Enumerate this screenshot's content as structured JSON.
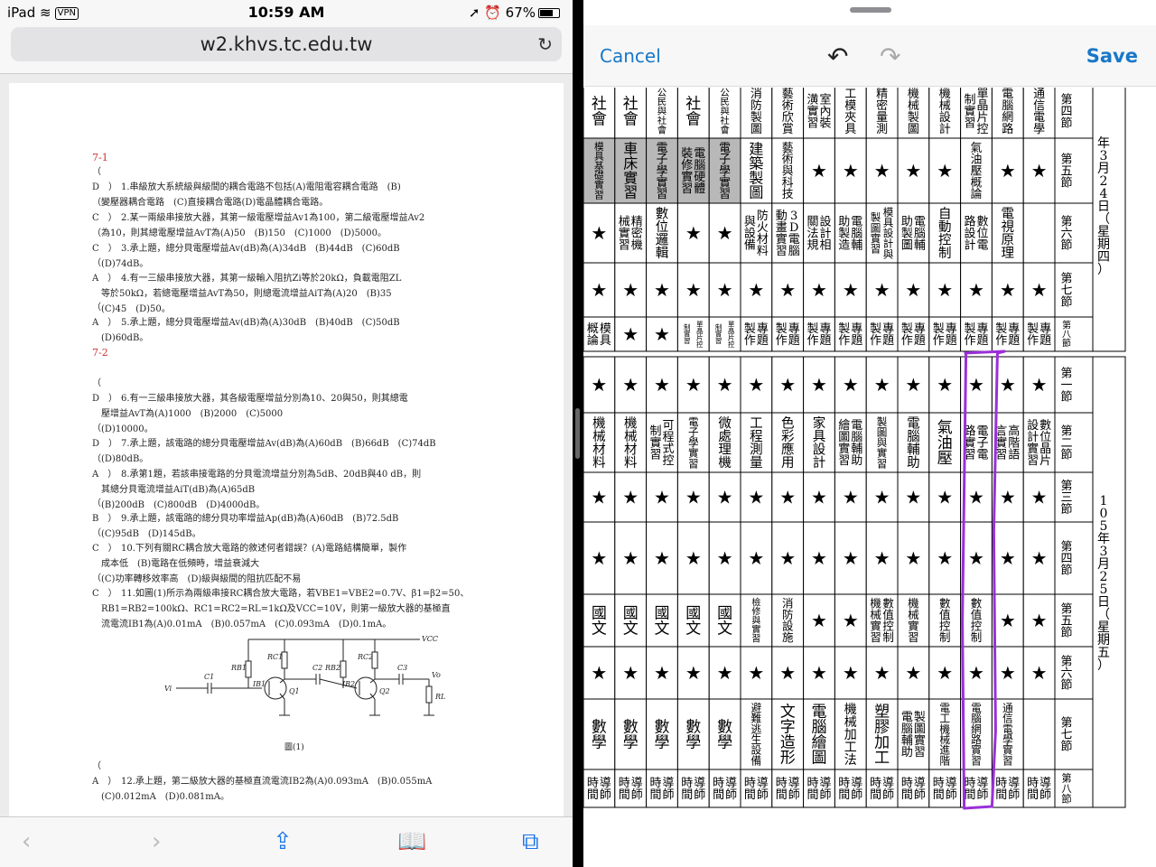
{
  "status": {
    "device": "iPad",
    "vpn": "VPN",
    "time": "10:59 AM",
    "battery": "67%"
  },
  "safari": {
    "url": "w2.khvs.tc.edu.tw"
  },
  "document": {
    "sections": [
      "7-1",
      "7-2"
    ],
    "questions": [
      {
        "answer": "（　D　）",
        "text": "1.串級放大系統級與級間的耦合電路不包括(A)電阻電容耦合電路　(B)\n　變壓器耦合電路　(C)直接耦合電路(D)電晶體耦合電路。"
      },
      {
        "answer": "（　C　）",
        "text": "2.某一兩級串接放大器，其第一級電壓增益Av1為100，第二級電壓增益Av2\n　為10，則其總電壓增益AvT為(A)50　(B)150　(C)1000　(D)5000。"
      },
      {
        "answer": "（　C　）",
        "text": "3.承上題，總分貝電壓增益Av(dB)為(A)34dB　(B)44dB　(C)60dB\n　(D)74dB。"
      },
      {
        "answer": "（　A　）",
        "text": "4.有一三級串接放大器，其第一級輸入阻抗Zi等於20kΩ，負載電阻ZL\n　等於50kΩ，若總電壓增益AvT為50，則總電流增益AiT為(A)20　(B)35\n　(C)45　(D)50。"
      },
      {
        "answer": "（　A　）",
        "text": "5.承上題，總分貝電壓增益Av(dB)為(A)30dB　(B)40dB　(C)50dB\n　(D)60dB。"
      },
      {
        "answer": "（　D　）",
        "text": "6.有一三級串接放大器，其各級電壓增益分別為10、20與50，則其總電\n　壓增益AvT為(A)1000　(B)2000　(C)5000\n　(D)10000。"
      },
      {
        "answer": "（　D　）",
        "text": "7.承上題，該電路的總分貝電壓增益Av(dB)為(A)60dB　(B)66dB　(C)74dB\n　(D)80dB。"
      },
      {
        "answer": "（　A　）",
        "text": "8.承第1題，若該串接電路的分貝電流增益分別為5dB、20dB與40 dB，則\n　其總分貝電流增益AiT(dB)為(A)65dB\n　(B)200dB　(C)800dB　(D)4000dB。"
      },
      {
        "answer": "（　B　）",
        "text": "9.承上題，該電路的總分貝功率增益Ap(dB)為(A)60dB　(B)72.5dB\n　(C)95dB　(D)145dB。"
      },
      {
        "answer": "（　C　）",
        "text": "10.下列有關RC耦合放大電路的敘述何者錯誤？(A)電路結構簡單，製作\n　成本低　(B)電路在低頻時，增益衰減大\n　(C)功率轉移效率高　(D)級與級間的阻抗匹配不易"
      },
      {
        "answer": "（　C　）",
        "text": "11.如圖(1)所示為兩級串接RC耦合放大電路，若VBE1=VBE2=0.7V、β1=β2=50、\n　RB1=RB2=100kΩ、RC1=RC2=RL=1kΩ及VCC=10V，則第一級放大器的基極直\n　流電流IB1為(A)0.01mA　(B)0.057mA　(C)0.093mA　(D)0.1mA。"
      },
      {
        "answer": "（　A　）",
        "text": "12.承上題，第二級放大器的基極直流電流IB2為(A)0.093mA　(B)0.055mA\n　(C)0.012mA　(D)0.081mA。"
      }
    ],
    "figure": {
      "caption": "圖(1)",
      "labels": {
        "vcc": "VCC",
        "rb1": "RB1",
        "rc1": "RC1",
        "rb2": "RB2",
        "rc2": "RC2",
        "ib1": "IB1",
        "ib2": "IB2",
        "q1": "Q1",
        "q2": "Q2",
        "c1": "C1",
        "c2": "C2",
        "c3": "C3",
        "rl": "RL",
        "vi": "Vi",
        "vo": "Vo"
      }
    }
  },
  "editor": {
    "cancel": "Cancel",
    "save": "Save"
  },
  "schedule": {
    "date_top": "年3月24日（星期四）",
    "date_mid": "105年3月25日（星期五）",
    "star": "★",
    "top_rows": [
      {
        "period": "第四節",
        "cells": [
          "社會",
          "社會",
          "公民與社會",
          "社會",
          "公民與社會",
          "消防製圖",
          "藝術欣賞",
          "室內裝潢實習",
          "工模夾具",
          "精密量測",
          "機械製圖",
          "機械設計",
          "單晶片控制實習",
          "電腦網路",
          "通信電學"
        ]
      },
      {
        "period": "第五節",
        "cells": [
          "模具基礎實習",
          "車床實習",
          "電子學實習",
          "電腦硬體裝修實習",
          "電子學實習",
          "建築製圖",
          "藝術與科技",
          "★",
          "★",
          "★",
          "★",
          "★",
          "氣油壓概論",
          "★",
          "★"
        ]
      },
      {
        "period": "第六節",
        "cells": [
          "★",
          "精密機械實習",
          "數位邏輯",
          "★",
          "★",
          "防火材料與設備",
          "3D電腦動畫實習",
          "設計相關法規",
          "電腦輔助製造",
          "模具設計與製圖實習",
          "電腦輔助製圖",
          "自動控制",
          "數位電路設計",
          "電視原理",
          ""
        ]
      },
      {
        "period": "第七節",
        "cells": [
          "★",
          "★",
          "★",
          "★",
          "★",
          "★",
          "★",
          "★",
          "★",
          "★",
          "★",
          "★",
          "★",
          "★",
          "★"
        ]
      },
      {
        "period": "第八節",
        "cells": [
          "模具概論",
          "★",
          "★",
          "單晶片控制實習",
          "單晶片控制實習",
          "專題製作",
          "專題製作",
          "專題製作",
          "專題製作",
          "專題製作",
          "專題製作",
          "專題製作",
          "專題製作",
          "專題製作",
          "專題製作"
        ]
      }
    ],
    "bottom_rows": [
      {
        "period": "第一節",
        "cells": [
          "★",
          "★",
          "★",
          "★",
          "★",
          "★",
          "★",
          "★",
          "★",
          "★",
          "★",
          "★",
          "★",
          "★",
          "★"
        ]
      },
      {
        "period": "第二節",
        "cells": [
          "機械材料",
          "機械材料",
          "可程式控制實習",
          "電子學實習",
          "微處理機",
          "工程測量",
          "色彩應用",
          "家具設計",
          "電腦輔助繪圖實習",
          "製圖與實習",
          "電腦輔助",
          "氣油壓",
          "電子電路實習",
          "高階語言實習",
          "數位晶片設計實習"
        ]
      },
      {
        "period": "第三節",
        "cells": [
          "★",
          "★",
          "★",
          "★",
          "★",
          "★",
          "★",
          "★",
          "★",
          "★",
          "★",
          "★",
          "★",
          "★",
          "★"
        ]
      },
      {
        "period": "第四節",
        "cells": [
          "★",
          "★",
          "★",
          "★",
          "★",
          "★",
          "★",
          "★",
          "★",
          "★",
          "★",
          "★",
          "★",
          "★",
          "★"
        ]
      },
      {
        "period": "第五節",
        "cells": [
          "國文",
          "國文",
          "國文",
          "國文",
          "國文",
          "檢修與實習",
          "消防設施",
          "★",
          "★",
          "數值控制機械實習",
          "機械實習",
          "數值控制",
          "數值控制",
          "★",
          "★"
        ]
      },
      {
        "period": "第六節",
        "cells": [
          "★",
          "★",
          "★",
          "★",
          "★",
          "★",
          "★",
          "★",
          "★",
          "★",
          "★",
          "★",
          "★",
          "★",
          "★"
        ]
      },
      {
        "period": "第七節",
        "cells": [
          "數學",
          "數學",
          "數學",
          "數學",
          "數學",
          "避難逃生設備",
          "文字造形",
          "電腦繪圖",
          "機械加工法",
          "塑膠加工",
          "製圖實習電腦輔助",
          "電工機械進階",
          "電腦網路實習",
          "通信電學實習",
          ""
        ]
      },
      {
        "period": "第八節",
        "cells": [
          "導師時間",
          "導師時間",
          "導師時間",
          "導師時間",
          "導師時間",
          "導師時間",
          "導師時間",
          "導師時間",
          "導師時間",
          "導師時間",
          "導師時間",
          "導師時間",
          "導師時間",
          "導師時間",
          "導師時間"
        ]
      }
    ]
  },
  "colors": {
    "accent": "#1877c8",
    "highlight": "#9b30d9",
    "shaded": "#b8b8b8",
    "answer_red": "#cc3333"
  }
}
